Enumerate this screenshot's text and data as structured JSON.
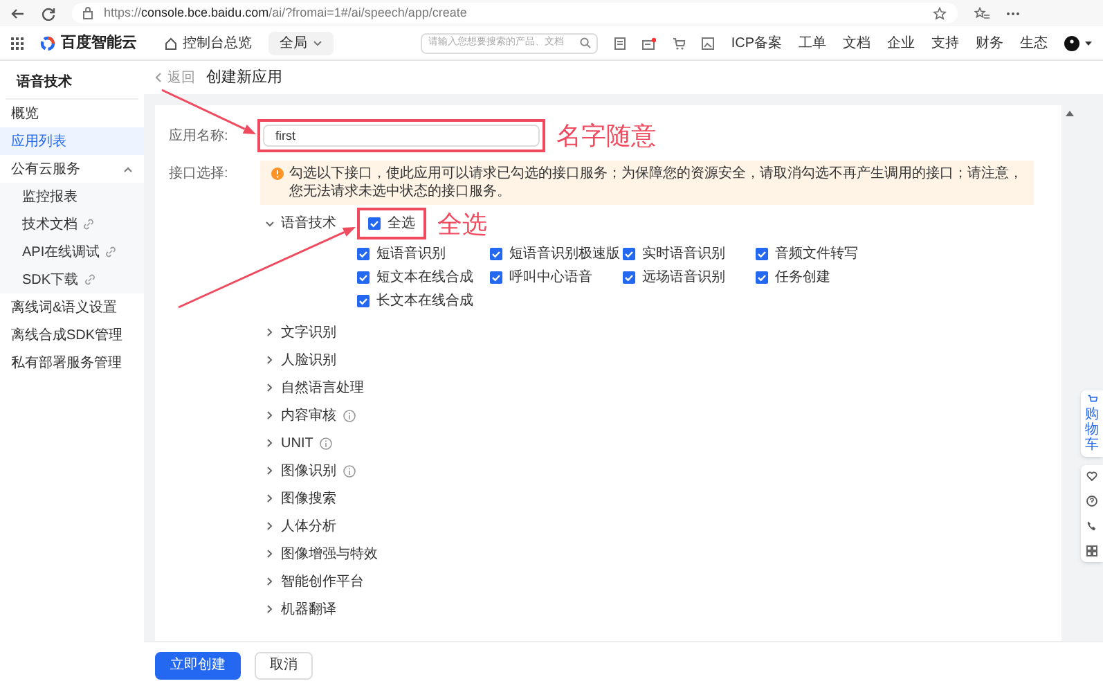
{
  "browser": {
    "url_prefix": "https://",
    "url_host": "console.bce.baidu.com",
    "url_path": "/ai/?fromai=1#/ai/speech/app/create"
  },
  "topnav": {
    "logo": "百度智能云",
    "overview": "控制台总览",
    "region": "全局",
    "search_placeholder": "请输入您想要搜索的产品、文档",
    "links": [
      "ICP备案",
      "工单",
      "文档",
      "企业",
      "支持",
      "财务",
      "生态"
    ],
    "message_unread": true
  },
  "sidebar": {
    "title": "语音技术",
    "items": [
      {
        "label": "概览",
        "selected": false
      },
      {
        "label": "应用列表",
        "selected": true
      },
      {
        "label": "公有云服务",
        "selected": false,
        "expanded": true,
        "children": [
          {
            "label": "监控报表",
            "selected": false,
            "link": false
          },
          {
            "label": "技术文档",
            "selected": false,
            "link": true
          },
          {
            "label": "API在线调试",
            "selected": false,
            "link": true
          },
          {
            "label": "SDK下载",
            "selected": false,
            "link": true
          }
        ]
      },
      {
        "label": "离线词&语义设置",
        "selected": false
      },
      {
        "label": "离线合成SDK管理",
        "selected": false
      },
      {
        "label": "私有部署服务管理",
        "selected": false
      }
    ]
  },
  "header": {
    "back": "返回",
    "title": "创建新应用"
  },
  "form": {
    "name_label": "应用名称:",
    "name_value": "first",
    "api_label": "接口选择:",
    "notice": "勾选以下接口，使此应用可以请求已勾选的接口服务；为保障您的资源安全，请取消勾选不再产生调用的接口；请注意，您无法请求未选中状态的接口服务。",
    "groups": [
      {
        "label": "语音技术",
        "expanded": true,
        "info": false,
        "select_all": {
          "label": "全选",
          "checked": true
        },
        "options": [
          {
            "label": "短语音识别",
            "checked": true
          },
          {
            "label": "短语音识别极速版",
            "checked": true
          },
          {
            "label": "实时语音识别",
            "checked": true
          },
          {
            "label": "音频文件转写",
            "checked": true
          },
          {
            "label": "短文本在线合成",
            "checked": true
          },
          {
            "label": "呼叫中心语音",
            "checked": true
          },
          {
            "label": "远场语音识别",
            "checked": true
          },
          {
            "label": "任务创建",
            "checked": true
          },
          {
            "label": "长文本在线合成",
            "checked": true
          }
        ]
      },
      {
        "label": "文字识别",
        "expanded": false,
        "info": false
      },
      {
        "label": "人脸识别",
        "expanded": false,
        "info": false
      },
      {
        "label": "自然语言处理",
        "expanded": false,
        "info": false
      },
      {
        "label": "内容审核",
        "expanded": false,
        "info": true
      },
      {
        "label": "UNIT",
        "expanded": false,
        "info": true
      },
      {
        "label": "图像识别",
        "expanded": false,
        "info": true
      },
      {
        "label": "图像搜索",
        "expanded": false,
        "info": false
      },
      {
        "label": "人体分析",
        "expanded": false,
        "info": false
      },
      {
        "label": "图像增强与特效",
        "expanded": false,
        "info": false
      },
      {
        "label": "智能创作平台",
        "expanded": false,
        "info": false
      },
      {
        "label": "机器翻译",
        "expanded": false,
        "info": false
      }
    ]
  },
  "footer": {
    "buttons": [
      {
        "label": "立即创建",
        "kind": "primary"
      },
      {
        "label": "取消",
        "kind": "default"
      }
    ]
  },
  "float_toolbar": {
    "cart": "购物车"
  },
  "annotations": [
    {
      "text": "名字随意"
    },
    {
      "text": "全选"
    }
  ]
}
